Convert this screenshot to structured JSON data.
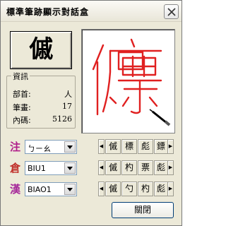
{
  "window": {
    "title": "標準筆跡顯示對話盒"
  },
  "preview": {
    "character": "傶"
  },
  "info": {
    "legend": "資訊",
    "radical_label": "部首:",
    "radical_value": "人",
    "strokes_label": "筆畫:",
    "strokes_value": "17",
    "code_label": "內碼:",
    "code_value": "5126"
  },
  "input_methods": [
    {
      "icon": "注",
      "value": "ㄅㄧㄠ",
      "icon_name": "zhuyin-icon"
    },
    {
      "icon": "倉",
      "value": "BIU1",
      "icon_name": "cangjie-icon"
    },
    {
      "icon": "漢",
      "value": "BIAO1",
      "icon_name": "pinyin-icon"
    }
  ],
  "candidate_strips": [
    {
      "chars": [
        "傶",
        "標",
        "彪",
        "鏢"
      ]
    },
    {
      "chars": [
        "傶",
        "杓",
        "票",
        "彪"
      ]
    },
    {
      "chars": [
        "傶",
        "勺",
        "杓",
        "彪"
      ]
    }
  ],
  "buttons": {
    "close_label": "關閉"
  },
  "colors": {
    "stroke_red": "#e02020",
    "accent_purple": "#b01e8a"
  }
}
